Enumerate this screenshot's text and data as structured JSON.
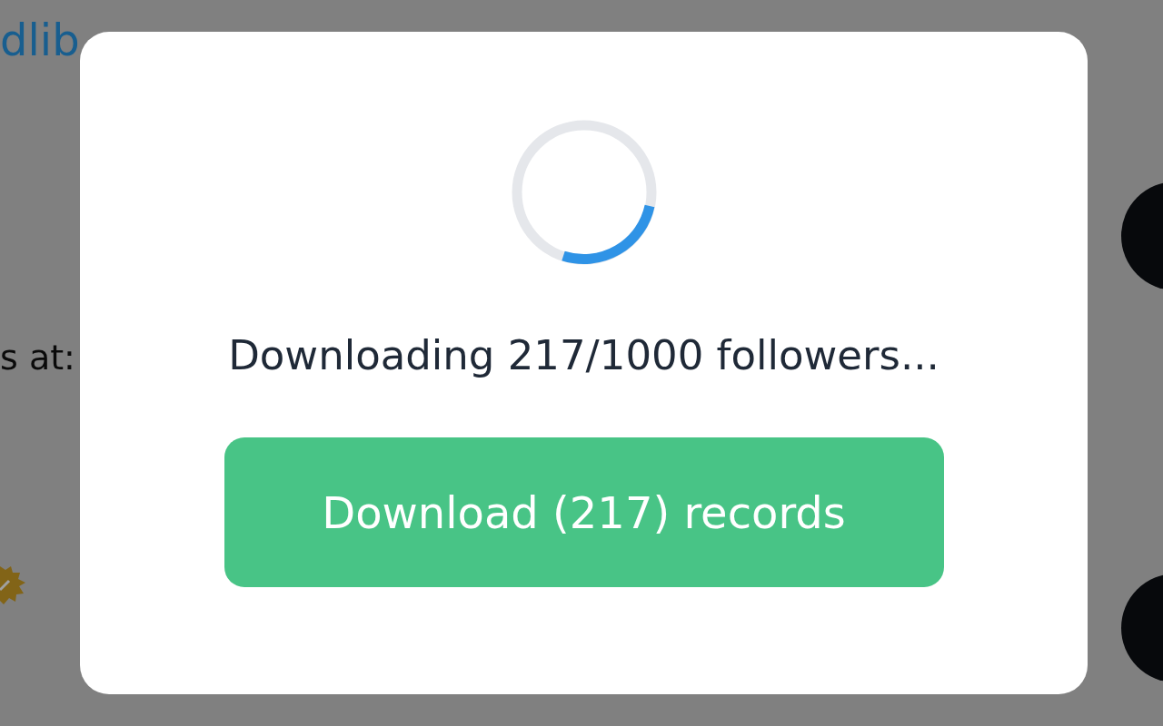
{
  "background": {
    "link_fragment": "dlib",
    "text_fragment": "s at:"
  },
  "modal": {
    "message": "Downloading 217/1000 followers...",
    "download_button": "Download (217) records"
  }
}
